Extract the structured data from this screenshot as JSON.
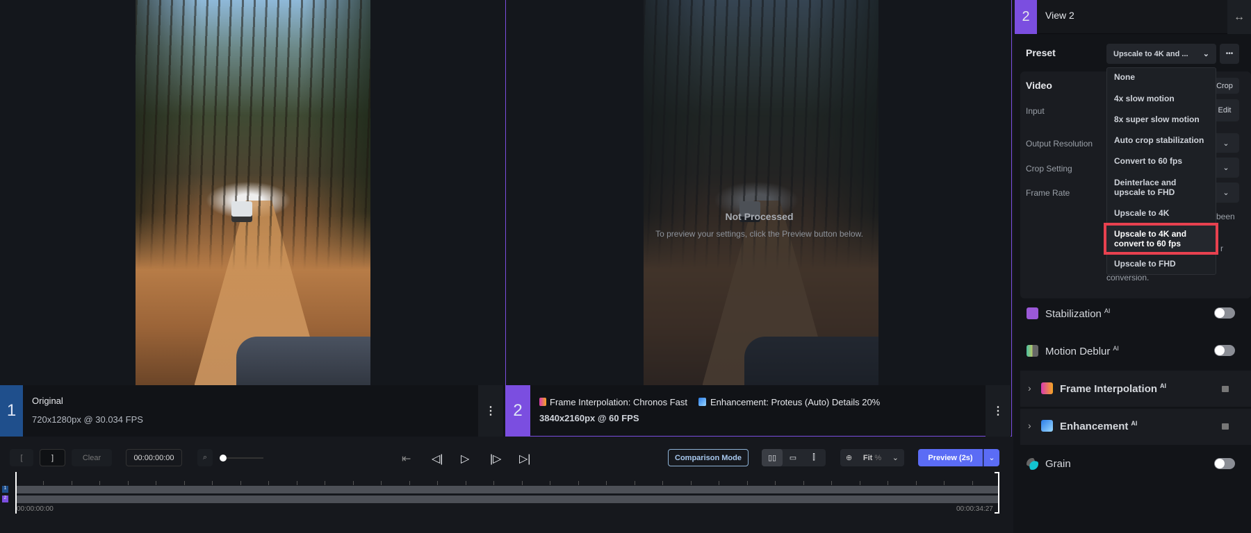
{
  "views": [
    {
      "number": "1",
      "title": "Original",
      "info": "720x1280px @ 30.034 FPS",
      "color": "#1f4f8c"
    },
    {
      "number": "2",
      "filter1": "Frame Interpolation: Chronos Fast",
      "filter2": "Enhancement: Proteus (Auto) Details 20%",
      "info": "3840x2160px @ 60 FPS",
      "color": "#7b4ee0",
      "overlay_title": "Not Processed",
      "overlay_text": "To preview your settings, click the Preview button below."
    }
  ],
  "panel": {
    "view_number": "2",
    "view_title": "View 2",
    "swap_icon": "↔",
    "preset_label": "Preset",
    "preset_value": "Upscale to 4K and ...",
    "more": "•••",
    "preset_options": [
      "None",
      "4x slow motion",
      "8x super slow motion",
      "Auto crop stabilization",
      "Convert to 60 fps",
      "Deinterlace and upscale to FHD",
      "Upscale to 4K",
      "Upscale to 4K and convert to 60 fps",
      "Upscale to FHD"
    ],
    "highlighted_option": "Upscale to 4K and convert to 60 fps",
    "video_label": "Video",
    "crop_button": "Crop",
    "edit_button": "Edit",
    "input_label": "Input",
    "output_resolution_label": "Output Resolution",
    "crop_setting_label": "Crop Setting",
    "frame_rate_label": "Frame Rate",
    "note_fragment_1": "been",
    "note_fragment_2": "r",
    "note_fragment_3": "conversion.",
    "features": [
      {
        "name": "Stabilization",
        "badge": "AI",
        "enabled": false
      },
      {
        "name": "Motion Deblur",
        "badge": "AI",
        "enabled": false
      },
      {
        "name": "Frame Interpolation",
        "badge": "AI",
        "locked": true
      },
      {
        "name": "Enhancement",
        "badge": "AI",
        "locked": true
      },
      {
        "name": "Grain",
        "enabled": false
      }
    ],
    "highlight_color": "#e8414f",
    "accent": "#5b6cf5"
  },
  "toolbar": {
    "mark_in": "[",
    "mark_out": "]",
    "clear": "Clear",
    "timecode": "00:00:00:00",
    "comparison_mode": "Comparison Mode",
    "zoom_value": "Fit",
    "zoom_unit": "%",
    "preview": "Preview (2s)"
  },
  "timeline": {
    "start": "00:00:00:00",
    "end": "00:00:34:27",
    "track_labels": [
      "1",
      "2"
    ],
    "playhead": 0
  }
}
